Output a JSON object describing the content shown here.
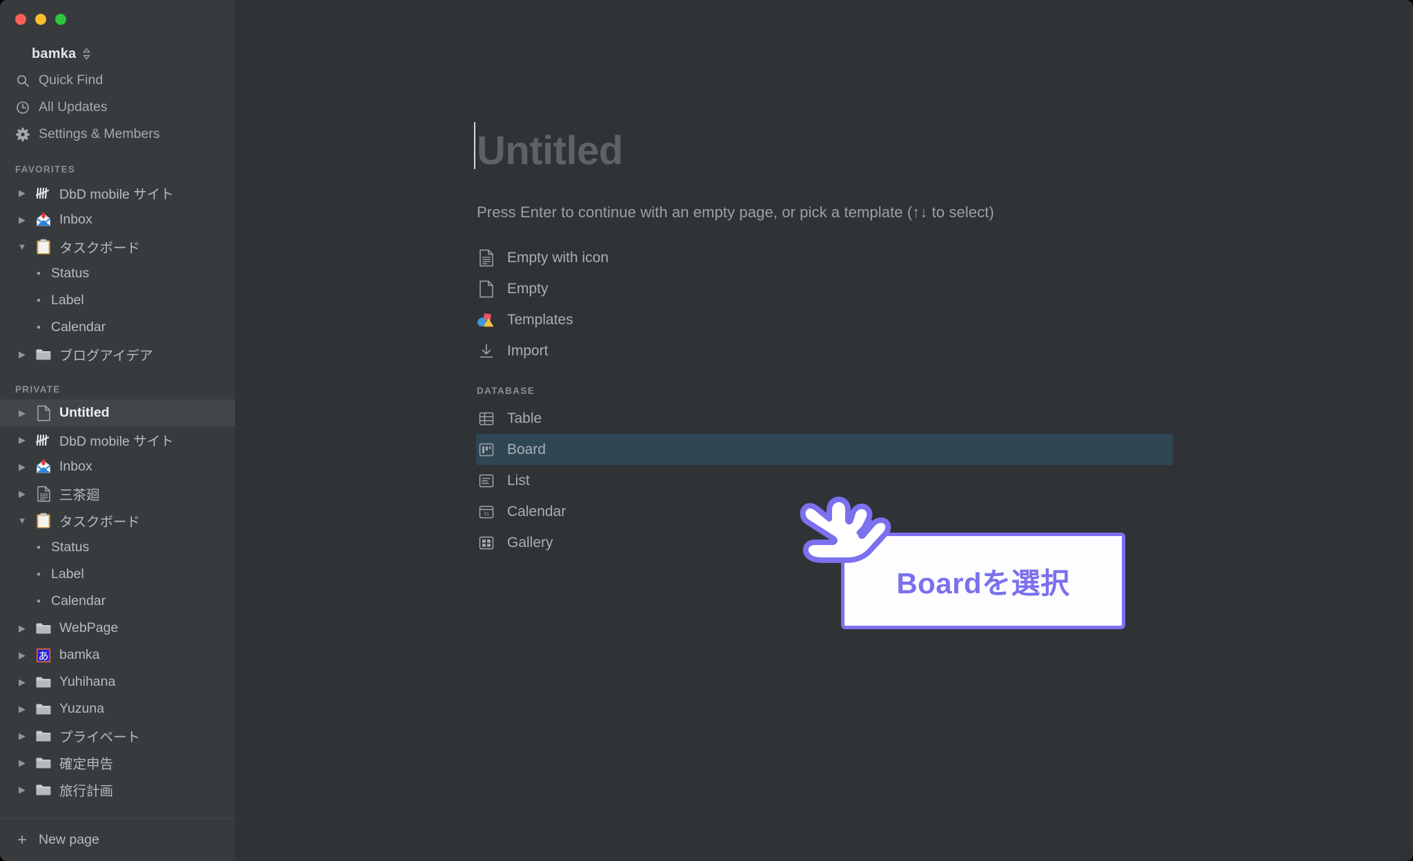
{
  "window": {
    "traffic_lights": [
      "close-red",
      "minimize-yellow",
      "maximize-green"
    ],
    "colors": {
      "sidebar_bg": "#373b3e",
      "main_bg": "#2f3336",
      "selected_row": "#42464a",
      "highlight_row": "#2f4654",
      "accent_purple": "#7b70ee",
      "text_primary": "#b6bbbf",
      "text_muted": "#8a9094"
    }
  },
  "sidebar": {
    "workspace": {
      "name": "bamka",
      "switcher_icon": "chevron-updown-icon"
    },
    "nav": [
      {
        "label": "Quick Find",
        "icon": "search-icon"
      },
      {
        "label": "All Updates",
        "icon": "clock-icon"
      },
      {
        "label": "Settings & Members",
        "icon": "gear-icon"
      }
    ],
    "favorites": {
      "title": "FAVORITES",
      "items": [
        {
          "label": "DbD mobile サイト",
          "icon": "tally-emoji",
          "arrow": "collapsed",
          "level": 0
        },
        {
          "label": "Inbox",
          "icon": "inbox-tray-emoji",
          "arrow": "collapsed",
          "level": 0
        },
        {
          "label": "タスクボード",
          "icon": "clipboard-emoji",
          "arrow": "expanded",
          "level": 0
        },
        {
          "label": "Status",
          "icon": "bullet",
          "arrow": "none",
          "level": 1
        },
        {
          "label": "Label",
          "icon": "bullet",
          "arrow": "none",
          "level": 1
        },
        {
          "label": "Calendar",
          "icon": "bullet",
          "arrow": "none",
          "level": 1
        },
        {
          "label": "ブログアイデア",
          "icon": "folder-emoji",
          "arrow": "collapsed",
          "level": 0
        }
      ]
    },
    "private": {
      "title": "PRIVATE",
      "items": [
        {
          "label": "Untitled",
          "icon": "page-emoji",
          "arrow": "collapsed",
          "level": 0,
          "selected": true
        },
        {
          "label": "DbD mobile サイト",
          "icon": "tally-emoji",
          "arrow": "collapsed",
          "level": 0
        },
        {
          "label": "Inbox",
          "icon": "inbox-tray-emoji",
          "arrow": "collapsed",
          "level": 0
        },
        {
          "label": "三茶廻",
          "icon": "document-emoji",
          "arrow": "collapsed",
          "level": 0
        },
        {
          "label": "タスクボード",
          "icon": "clipboard-emoji",
          "arrow": "expanded",
          "level": 0
        },
        {
          "label": "Status",
          "icon": "bullet",
          "arrow": "none",
          "level": 1
        },
        {
          "label": "Label",
          "icon": "bullet",
          "arrow": "none",
          "level": 1
        },
        {
          "label": "Calendar",
          "icon": "bullet",
          "arrow": "none",
          "level": 1
        },
        {
          "label": "WebPage",
          "icon": "folder-emoji",
          "arrow": "collapsed",
          "level": 0
        },
        {
          "label": "bamka",
          "icon": "japanese-a-emoji",
          "arrow": "collapsed",
          "level": 0
        },
        {
          "label": "Yuhihana",
          "icon": "folder-emoji",
          "arrow": "collapsed",
          "level": 0
        },
        {
          "label": "Yuzuna",
          "icon": "folder-emoji",
          "arrow": "collapsed",
          "level": 0
        },
        {
          "label": "プライベート",
          "icon": "folder-emoji",
          "arrow": "collapsed",
          "level": 0
        },
        {
          "label": "確定申告",
          "icon": "folder-emoji",
          "arrow": "collapsed",
          "level": 0
        },
        {
          "label": "旅行計画",
          "icon": "folder-emoji",
          "arrow": "collapsed",
          "level": 0
        }
      ]
    },
    "footer": {
      "label": "New page",
      "icon": "plus-icon"
    }
  },
  "main": {
    "title": "Untitled",
    "hint": "Press Enter to continue with an empty page, or pick a template (↑↓ to select)",
    "options": [
      {
        "label": "Empty with icon",
        "icon": "page-with-lines-icon"
      },
      {
        "label": "Empty",
        "icon": "blank-page-icon"
      },
      {
        "label": "Templates",
        "icon": "templates-colored-icon"
      },
      {
        "label": "Import",
        "icon": "download-arrow-icon"
      }
    ],
    "database_section": {
      "title": "DATABASE",
      "options": [
        {
          "label": "Table",
          "icon": "table-icon",
          "highlighted": false
        },
        {
          "label": "Board",
          "icon": "board-icon",
          "highlighted": true
        },
        {
          "label": "List",
          "icon": "list-icon",
          "highlighted": false
        },
        {
          "label": "Calendar",
          "icon": "calendar-31-icon",
          "highlighted": false
        },
        {
          "label": "Gallery",
          "icon": "gallery-grid-icon",
          "highlighted": false
        }
      ]
    }
  },
  "annotation": {
    "callout_text": "Boardを選択",
    "cursor_icon": "pointing-hand-cursor",
    "color": "#7b70ee"
  }
}
